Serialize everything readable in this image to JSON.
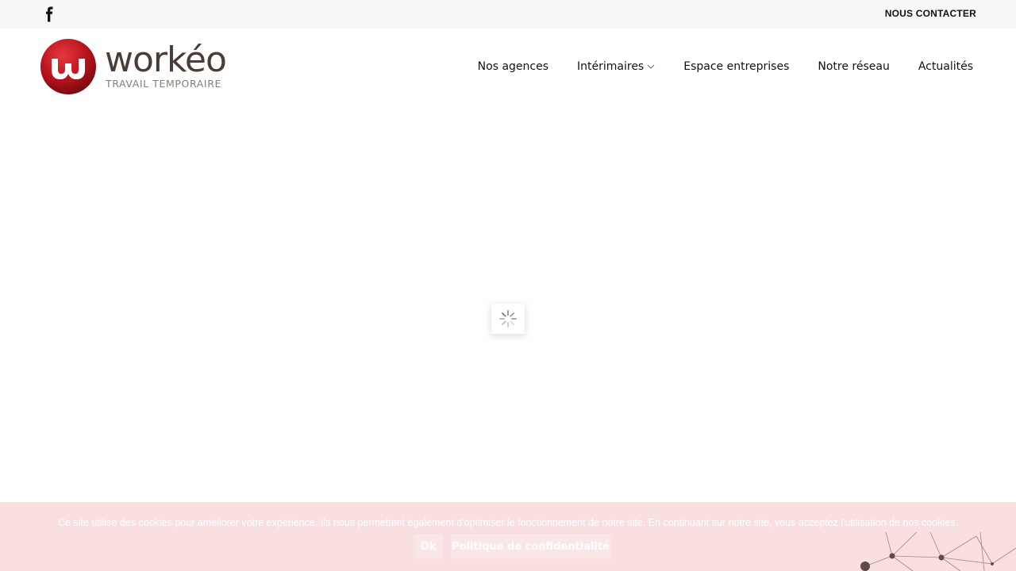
{
  "topbar": {
    "facebook_icon": "facebook-icon",
    "contact_label": "NOUS CONTACTER"
  },
  "header": {
    "logo_text": "workéo",
    "logo_subtitle": "TRAVAIL TEMPORAIRE",
    "nav": [
      {
        "label": "Nos agences"
      },
      {
        "label": "Intérimaires",
        "has_dropdown": true
      },
      {
        "label": "Espace entreprises"
      },
      {
        "label": "Notre réseau"
      },
      {
        "label": "Actualités"
      }
    ]
  },
  "loader": {
    "icon": "spinner-icon"
  },
  "cookie_banner": {
    "text": "Ce site utilise des cookies pour améliorer votre expérience. Ils nous permettent également d'optimiser le fonctionnement de notre site. En continuant sur notre site, vous acceptez l'utilisation de nos cookies.",
    "ok_label": "Ok",
    "policy_label": "Politique de confidentialité",
    "background_color": "#f9dfe0"
  },
  "colors": {
    "brand_red": "#b5121b",
    "brand_brown": "#4a3d36"
  }
}
